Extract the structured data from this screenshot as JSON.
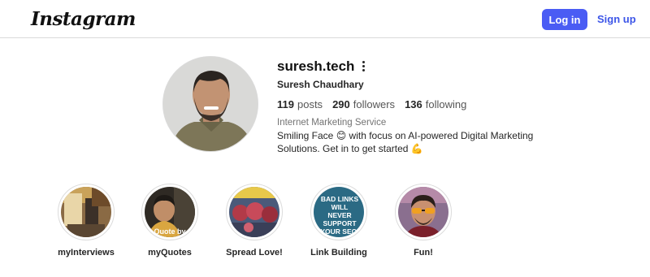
{
  "header": {
    "logo": "Instagram",
    "login_label": "Log in",
    "signup_label": "Sign up"
  },
  "profile": {
    "username": "suresh.tech",
    "full_name": "Suresh Chaudhary",
    "stats": {
      "posts_count": "119",
      "posts_label": "posts",
      "followers_count": "290",
      "followers_label": "followers",
      "following_count": "136",
      "following_label": "following"
    },
    "category": "Internet Marketing Service",
    "bio_part1": "Smiling Face ",
    "bio_emoji1": "😊",
    "bio_part2": " with focus on AI-powered Digital Marketing Solutions. Get in to get started ",
    "bio_emoji2": "💪"
  },
  "highlights": [
    {
      "label": "myInterviews"
    },
    {
      "label": "myQuotes",
      "overlay_text": "Quote by"
    },
    {
      "label": "Spread Love!"
    },
    {
      "label": "Link Building",
      "overlay_text": "BAD LINKS WILL NEVER SUPPORT YOUR SEO."
    },
    {
      "label": "Fun!"
    }
  ],
  "colors": {
    "accent_button": "#4a5cf4",
    "link": "#3d56e8",
    "border": "#dbdbdb"
  }
}
